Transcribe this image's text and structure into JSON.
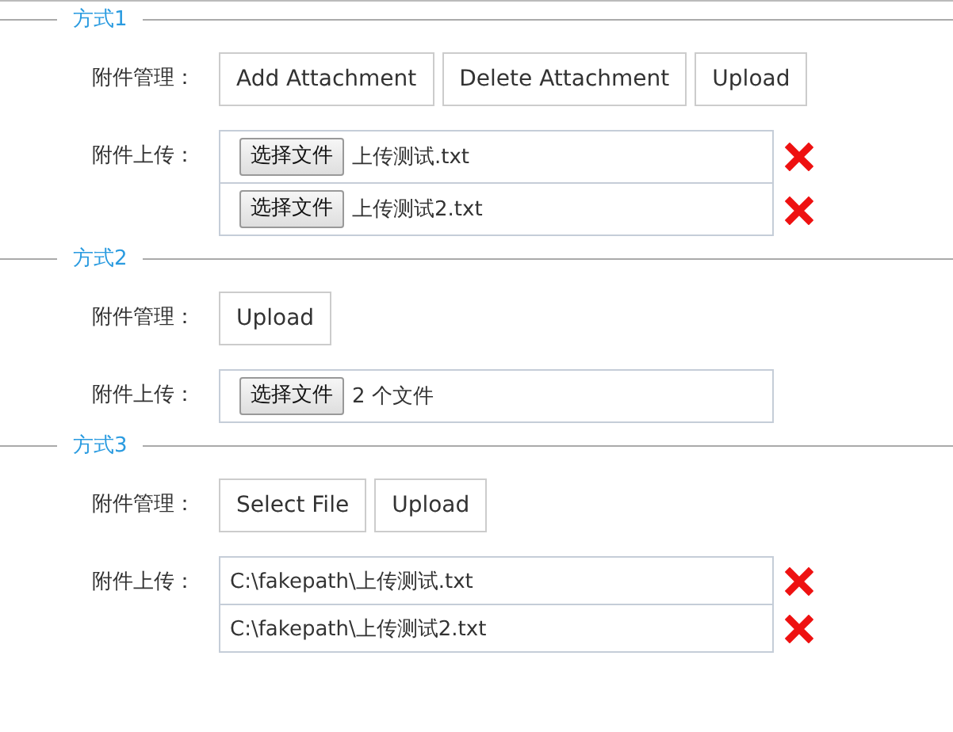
{
  "sections": [
    {
      "legend": "方式1",
      "manage_label": "附件管理：",
      "buttons": [
        "Add Attachment",
        "Delete Attachment",
        "Upload"
      ],
      "upload_label": "附件上传：",
      "files": [
        {
          "kind": "chooser",
          "button": "选择文件",
          "value": "上传测试.txt",
          "removable": true
        },
        {
          "kind": "chooser",
          "button": "选择文件",
          "value": "上传测试2.txt",
          "removable": true
        }
      ]
    },
    {
      "legend": "方式2",
      "manage_label": "附件管理：",
      "buttons": [
        "Upload"
      ],
      "upload_label": "附件上传：",
      "files": [
        {
          "kind": "chooser",
          "button": "选择文件",
          "value": "2 个文件",
          "removable": false
        }
      ]
    },
    {
      "legend": "方式3",
      "manage_label": "附件管理：",
      "buttons": [
        "Select File",
        "Upload"
      ],
      "upload_label": "附件上传：",
      "files": [
        {
          "kind": "path",
          "value": "C:\\fakepath\\上传测试.txt",
          "removable": true
        },
        {
          "kind": "path",
          "value": "C:\\fakepath\\上传测试2.txt",
          "removable": true
        }
      ]
    }
  ]
}
